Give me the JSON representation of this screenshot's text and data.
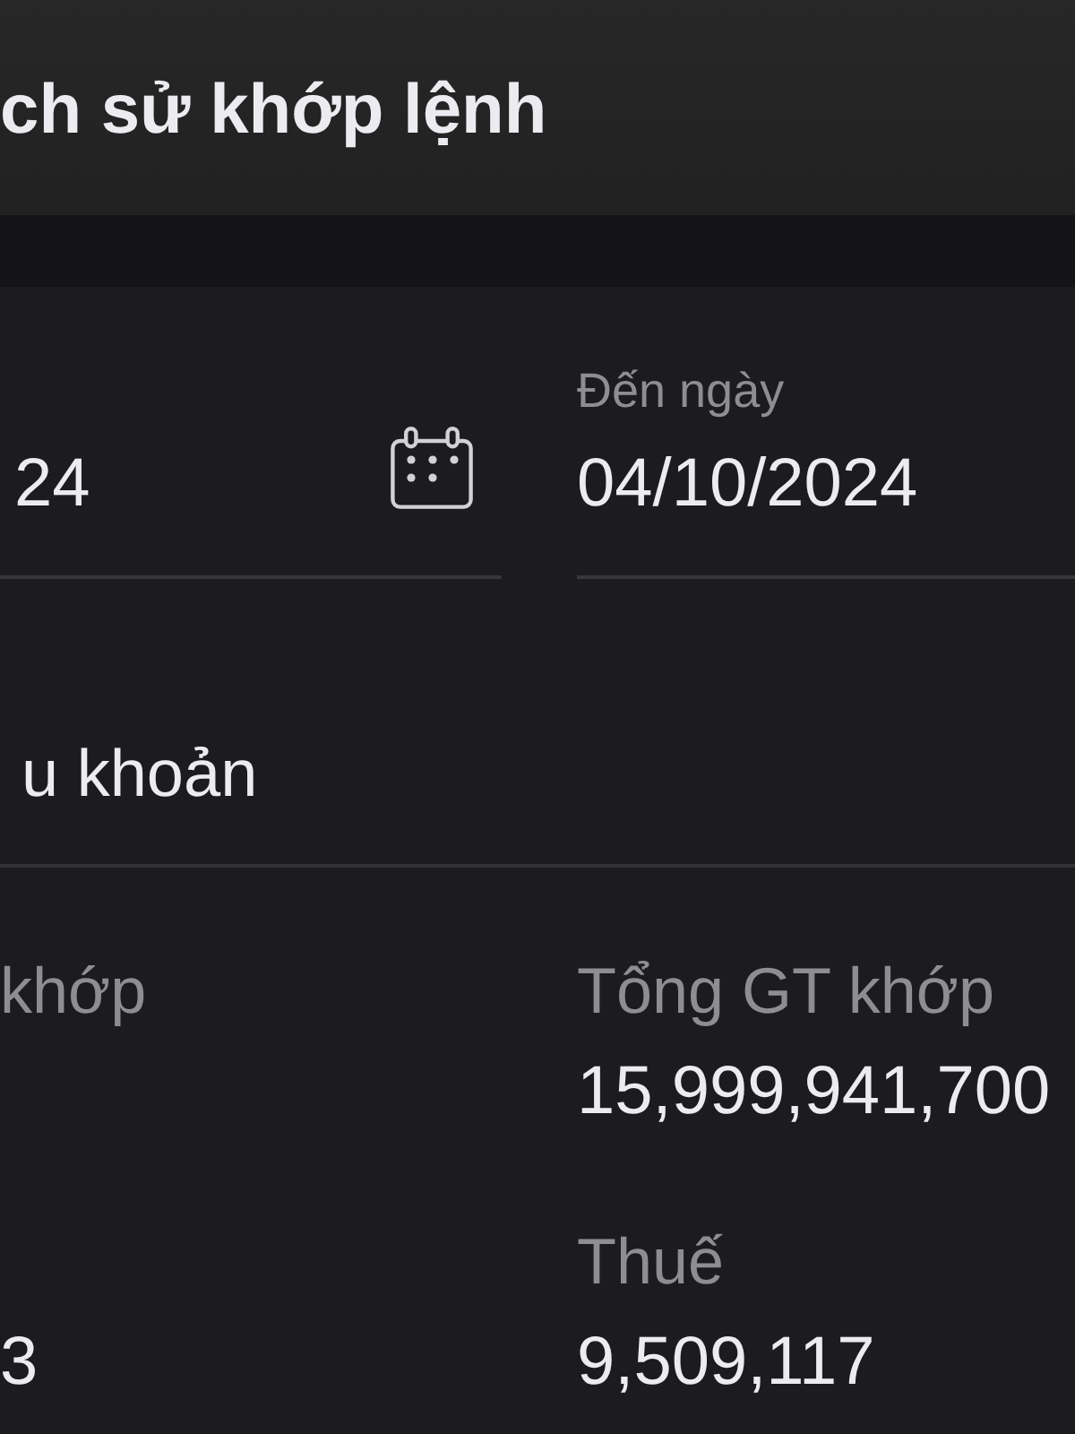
{
  "header": {
    "title": "ch sử khớp lệnh"
  },
  "date_range": {
    "from": {
      "value": "24"
    },
    "to": {
      "label": "Đến ngày",
      "value": "04/10/2024"
    }
  },
  "sub_account": {
    "label": "u khoản"
  },
  "summary": {
    "left": [
      {
        "label": "khớp"
      },
      {
        "value": "3"
      }
    ],
    "right": [
      {
        "label": "Tổng GT khớp",
        "value": "15,999,941,700"
      },
      {
        "label": "Thuế",
        "value": "9,509,117"
      }
    ]
  }
}
